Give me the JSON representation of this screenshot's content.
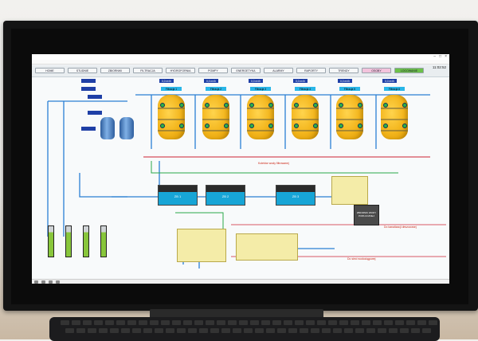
{
  "window": {
    "title": "",
    "clock": "11:02:52"
  },
  "menu": [],
  "nav": [
    {
      "label": "HOME"
    },
    {
      "label": "STUDNIE"
    },
    {
      "label": "ZBIORNIKI"
    },
    {
      "label": "FILTRACJA"
    },
    {
      "label": "HYDROFORNIA"
    },
    {
      "label": "POMPY"
    },
    {
      "label": "ENERGETYKA"
    },
    {
      "label": "ALARMY"
    },
    {
      "label": "RAPORTY"
    },
    {
      "label": "TRENDY"
    },
    {
      "label": "OSOBY"
    },
    {
      "label": "LOGOWANIE"
    }
  ],
  "filters": {
    "labels": [
      "Filtracja 1",
      "Filtracja 2",
      "Filtracja 3",
      "Filtracja 4",
      "Filtracja 5",
      "Filtracja 6"
    ],
    "flows": [
      "0,0 m³/h",
      "0,0 m³/h",
      "0,0 m³/h",
      "0,0 m³/h",
      "0,0 m³/h",
      "0,0 m³/h"
    ]
  },
  "reservoirs": {
    "labels": [
      "ZB 1",
      "ZB 2",
      "ZB 3"
    ]
  },
  "lines": {
    "collector": "Kolektor wody filtrowanej",
    "sewage": "Do kanalizacji deszczowej",
    "network": "Do sieci wodociągowej"
  },
  "tank_label": "ZBIORNIK WODY POPŁUCZNEJ",
  "colors": {
    "filter": "#f3b51c",
    "value_box": "#1f3fa6",
    "water": "#17a5d6",
    "yellow_zone": "#f4eca8"
  }
}
